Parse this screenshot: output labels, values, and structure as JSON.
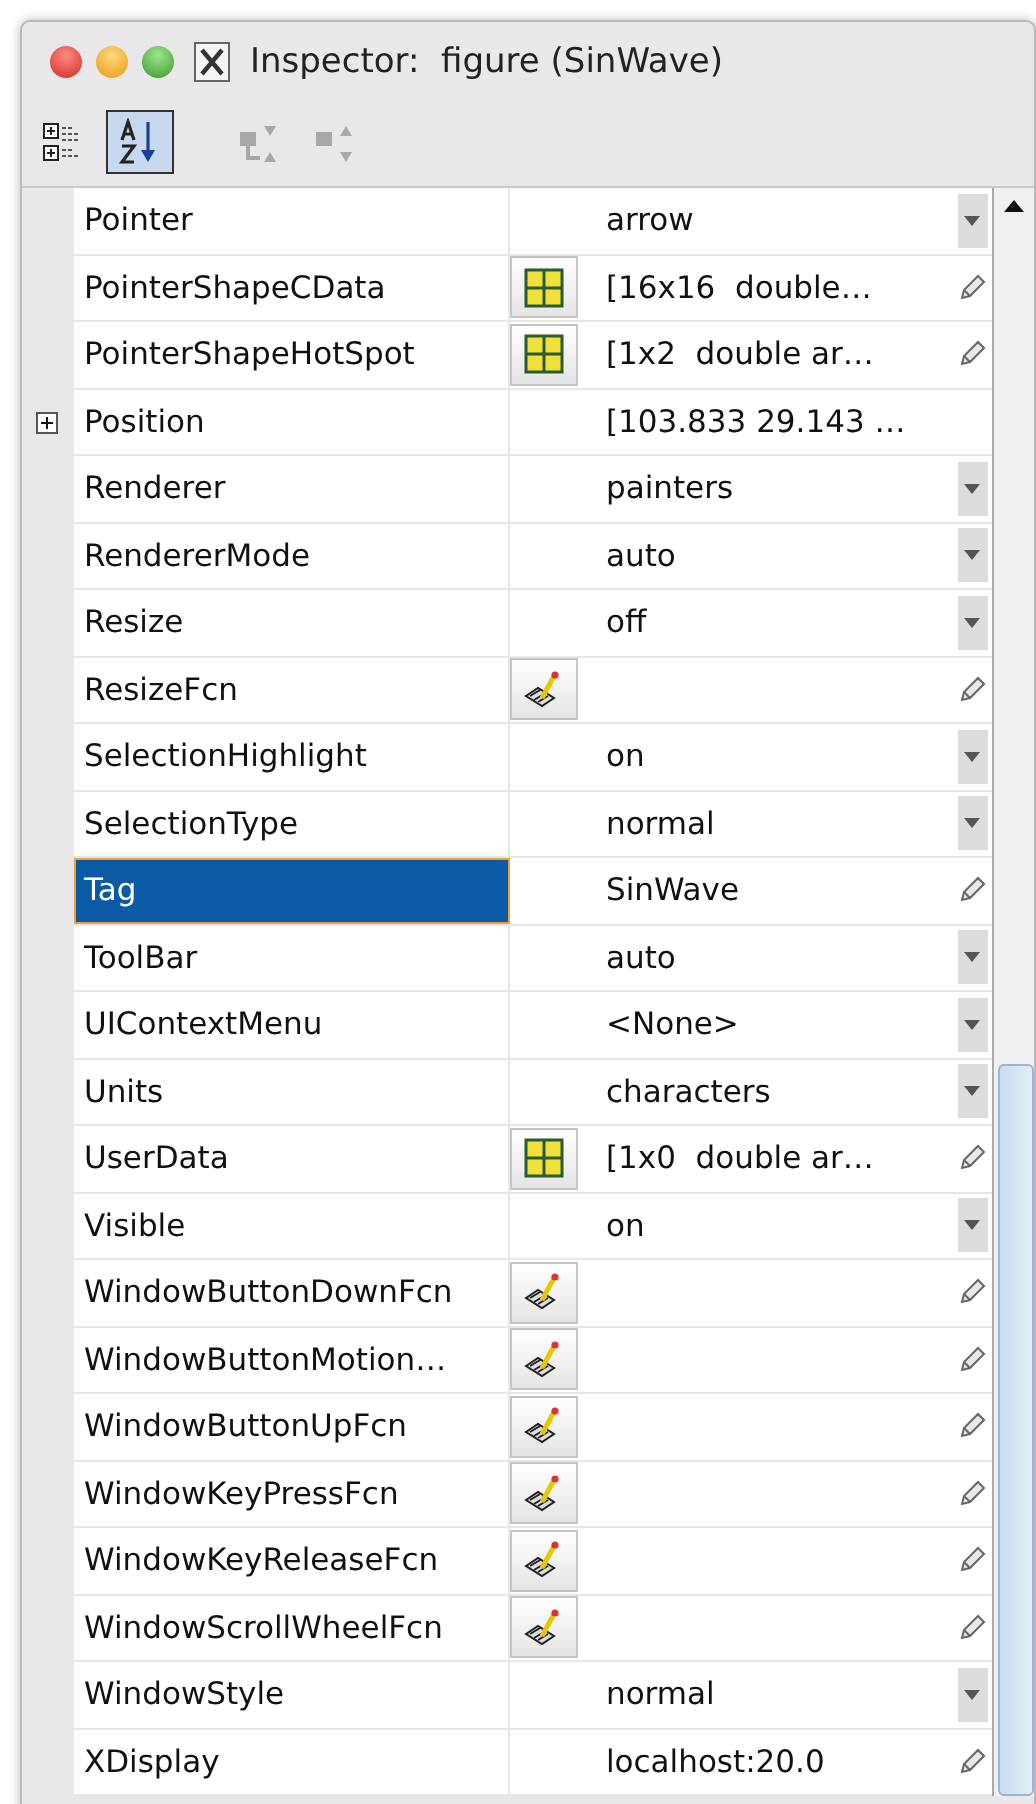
{
  "window": {
    "title": "Inspector:  figure (SinWave)"
  },
  "toolbar": [
    {
      "kind": "categorized",
      "selected": false,
      "disabled": false
    },
    {
      "kind": "alphabetical",
      "selected": true,
      "disabled": false
    },
    {
      "kind": "expand",
      "selected": false,
      "disabled": true
    },
    {
      "kind": "collapse",
      "selected": false,
      "disabled": true
    }
  ],
  "properties": [
    {
      "name": "Pointer",
      "value": "arrow",
      "control": {
        "kind": "dropdown"
      },
      "selected": false
    },
    {
      "name": "PointerShapeCData",
      "value": "[16x16  double…",
      "editor": {
        "kind": "matrix"
      },
      "control": {
        "kind": "edit"
      },
      "selected": false
    },
    {
      "name": "PointerShapeHotSpot",
      "value": "[1x2  double ar…",
      "editor": {
        "kind": "matrix"
      },
      "control": {
        "kind": "edit"
      },
      "selected": false
    },
    {
      "name": "Position",
      "value": "[103.833 29.143 …",
      "expandable": true,
      "selected": false
    },
    {
      "name": "Renderer",
      "value": "painters",
      "control": {
        "kind": "dropdown"
      },
      "selected": false
    },
    {
      "name": "RendererMode",
      "value": "auto",
      "control": {
        "kind": "dropdown"
      },
      "selected": false
    },
    {
      "name": "Resize",
      "value": "off",
      "control": {
        "kind": "dropdown"
      },
      "selected": false
    },
    {
      "name": "ResizeFcn",
      "editor": {
        "kind": "callback"
      },
      "control": {
        "kind": "edit"
      },
      "selected": false
    },
    {
      "name": "SelectionHighlight",
      "value": "on",
      "control": {
        "kind": "dropdown"
      },
      "selected": false
    },
    {
      "name": "SelectionType",
      "value": "normal",
      "control": {
        "kind": "dropdown"
      },
      "selected": false
    },
    {
      "name": "Tag",
      "value": "SinWave",
      "control": {
        "kind": "edit"
      },
      "selected": true
    },
    {
      "name": "ToolBar",
      "value": "auto",
      "control": {
        "kind": "dropdown"
      },
      "selected": false
    },
    {
      "name": "UIContextMenu",
      "value": "<None>",
      "control": {
        "kind": "dropdown"
      },
      "selected": false
    },
    {
      "name": "Units",
      "value": "characters",
      "control": {
        "kind": "dropdown"
      },
      "selected": false
    },
    {
      "name": "UserData",
      "value": "[1x0  double ar…",
      "editor": {
        "kind": "matrix"
      },
      "control": {
        "kind": "edit"
      },
      "selected": false
    },
    {
      "name": "Visible",
      "value": "on",
      "control": {
        "kind": "dropdown"
      },
      "selected": false
    },
    {
      "name": "WindowButtonDownFcn",
      "editor": {
        "kind": "callback"
      },
      "control": {
        "kind": "edit"
      },
      "selected": false
    },
    {
      "name": "WindowButtonMotion…",
      "editor": {
        "kind": "callback"
      },
      "control": {
        "kind": "edit"
      },
      "selected": false
    },
    {
      "name": "WindowButtonUpFcn",
      "editor": {
        "kind": "callback"
      },
      "control": {
        "kind": "edit"
      },
      "selected": false
    },
    {
      "name": "WindowKeyPressFcn",
      "editor": {
        "kind": "callback"
      },
      "control": {
        "kind": "edit"
      },
      "selected": false
    },
    {
      "name": "WindowKeyReleaseFcn",
      "editor": {
        "kind": "callback"
      },
      "control": {
        "kind": "edit"
      },
      "selected": false
    },
    {
      "name": "WindowScrollWheelFcn",
      "editor": {
        "kind": "callback"
      },
      "control": {
        "kind": "edit"
      },
      "selected": false
    },
    {
      "name": "WindowStyle",
      "value": "normal",
      "control": {
        "kind": "dropdown"
      },
      "selected": false
    },
    {
      "name": "XDisplay",
      "value": "localhost:20.0",
      "control": {
        "kind": "edit"
      },
      "selected": false
    }
  ]
}
